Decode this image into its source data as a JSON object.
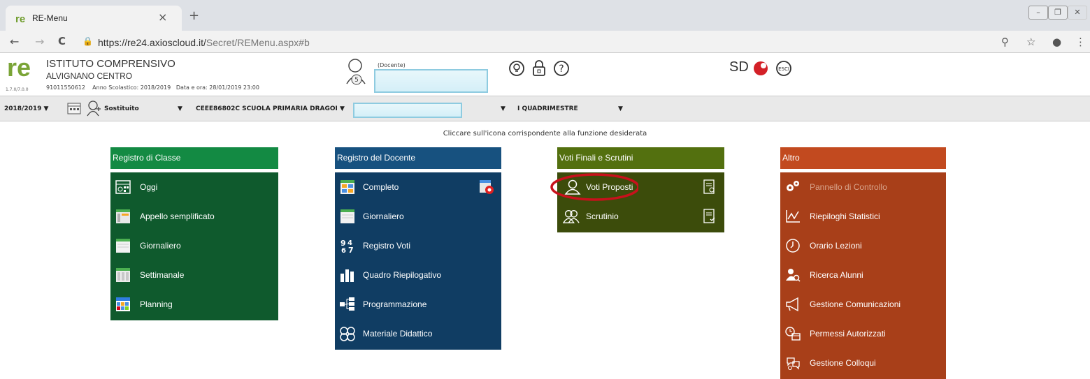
{
  "browser": {
    "tab_title": "RE-Menu",
    "tab_close": "×",
    "new_tab": "+",
    "url_main": "https://re24.axioscloud.it/",
    "url_path": "Secret/REMenu.aspx#b",
    "back": "←",
    "forward": "→",
    "reload": "C"
  },
  "header": {
    "logo": "re",
    "school_name": "ISTITUTO COMPRENSIVO",
    "school_place": "ALVIGNANO CENTRO",
    "version": "1.7.0/7.0.0",
    "code": "91011550612",
    "anno": "Anno Scolastico: 2018/2019",
    "data_ora": "Data e ora: 28/01/2019 23:00",
    "user_badge": "5",
    "docente_label": "(Docente)",
    "sd_logo": "SD",
    "esci": "ESCI"
  },
  "toolbar": {
    "year": "2018/2019",
    "sostituito": "Sostituito",
    "school_select": "CEEE86802C SCUOLA PRIMARIA DRAGOI",
    "period": "I QUADRIMESTRE",
    "caret": "▼"
  },
  "instruction": "Cliccare sull'icona corrispondente alla funzione desiderata",
  "colors": {
    "registro_classe": "#0f5a2d",
    "registro_classe_head": "#138a43",
    "registro_docente": "#103d63",
    "registro_docente_head": "#17517f",
    "voti_finali": "#3c4c0b",
    "voti_finali_head": "#53700f",
    "altro": "#a83f19",
    "altro_head": "#c24a1f"
  },
  "panels": {
    "classe": {
      "title": "Registro di Classe",
      "items": [
        "Oggi",
        "Appello semplificato",
        "Giornaliero",
        "Settimanale",
        "Planning"
      ]
    },
    "docente": {
      "title": "Registro del Docente",
      "items": [
        "Completo",
        "Giornaliero",
        "Registro Voti",
        "Quadro Riepilogativo",
        "Programmazione",
        "Materiale Didattico"
      ]
    },
    "voti": {
      "title": "Voti Finali e Scrutini",
      "items": [
        "Voti Proposti",
        "Scrutinio"
      ]
    },
    "altro": {
      "title": "Altro",
      "items": [
        "Pannello di Controllo",
        "Riepiloghi Statistici",
        "Orario Lezioni",
        "Ricerca Alunni",
        "Gestione Comunicazioni",
        "Permessi Autorizzati",
        "Gestione Colloqui"
      ]
    }
  }
}
